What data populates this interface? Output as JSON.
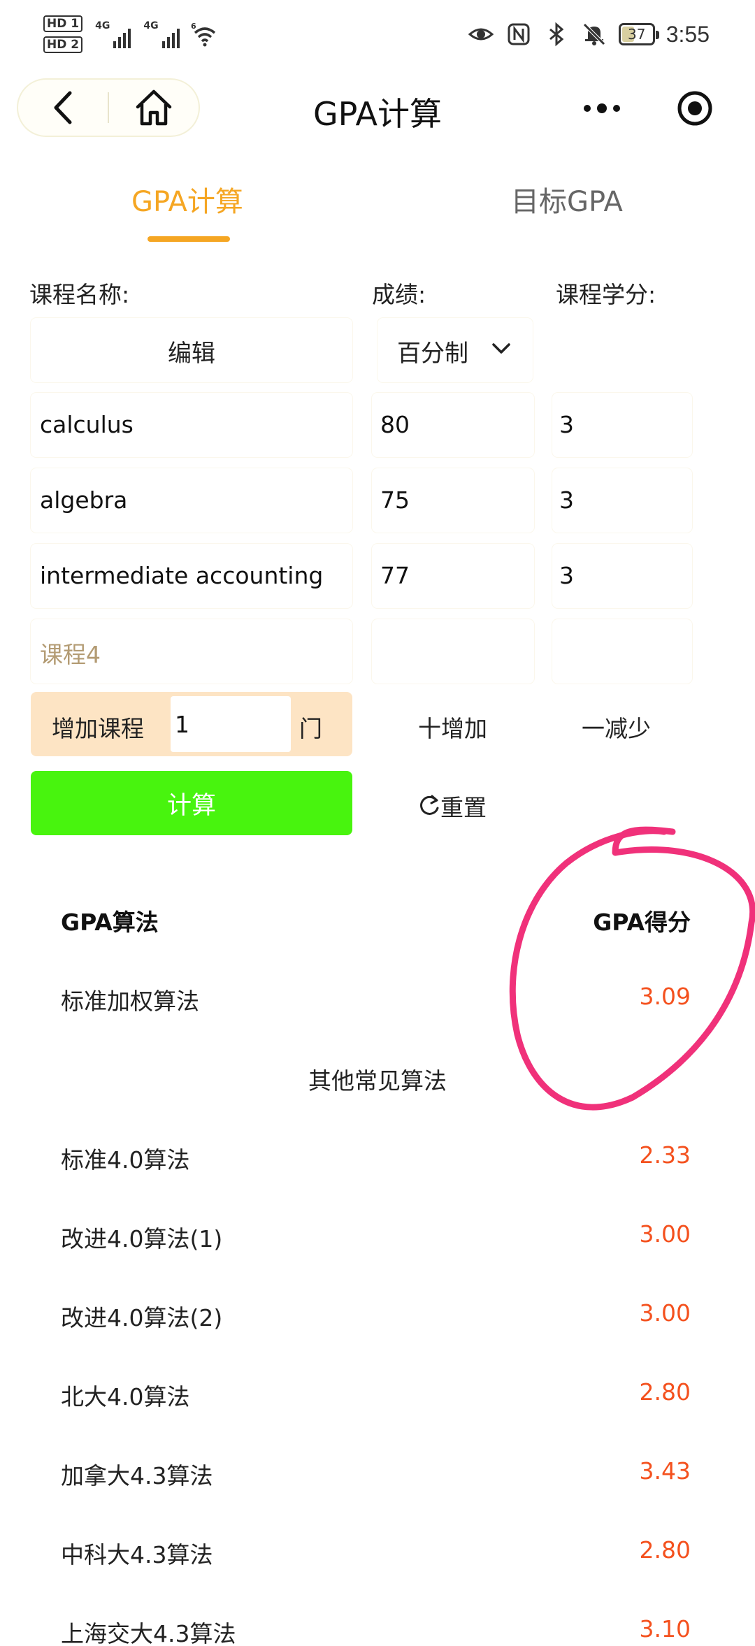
{
  "status_bar": {
    "hd_tags": [
      "HD 1",
      "HD 2"
    ],
    "network_1": "4G",
    "network_2": "4G",
    "wifi_badge": "6",
    "battery": "37",
    "time": "3:55",
    "icons": [
      "eye-icon",
      "nfc-icon",
      "bluetooth-icon",
      "mute-bell-icon"
    ]
  },
  "navbar": {
    "title": "GPA计算",
    "back_icon": "chevron-left-icon",
    "home_icon": "home-icon",
    "more_icon": "more-dots-icon",
    "close_icon": "target-icon"
  },
  "tabs": [
    {
      "label": "GPA计算",
      "active": true
    },
    {
      "label": "目标GPA",
      "active": false
    }
  ],
  "course_table": {
    "headers": {
      "name": "课程名称:",
      "score": "成绩:",
      "credit": "课程学分:"
    },
    "edit_label": "编辑",
    "scale_label": "百分制",
    "rows": [
      {
        "name": "calculus",
        "score": "80",
        "credit": "3"
      },
      {
        "name": "algebra",
        "score": "75",
        "credit": "3"
      },
      {
        "name": "intermediate accounting",
        "score": "77",
        "credit": "3"
      }
    ],
    "new_course_placeholder": "课程4"
  },
  "add_course": {
    "label": "增加课程",
    "value": "1",
    "unit": "门",
    "add_label": "十增加",
    "reduce_label": "一减少"
  },
  "actions": {
    "calculate": "计算",
    "reset": "重置"
  },
  "results": {
    "header_algo": "GPA算法",
    "header_score": "GPA得分",
    "standard": {
      "name": "标准加权算法",
      "value": "3.09"
    },
    "other_title": "其他常见算法",
    "others": [
      {
        "name": "标准4.0算法",
        "value": "2.33"
      },
      {
        "name": "改进4.0算法(1)",
        "value": "3.00"
      },
      {
        "name": "改进4.0算法(2)",
        "value": "3.00"
      },
      {
        "name": "北大4.0算法",
        "value": "2.80"
      },
      {
        "name": "加拿大4.3算法",
        "value": "3.43"
      },
      {
        "name": "中科大4.3算法",
        "value": "2.80"
      },
      {
        "name": "上海交大4.3算法",
        "value": "3.10"
      }
    ]
  },
  "colors": {
    "accent": "#f5a623",
    "calc_button": "#48f40e",
    "score_value": "#f4511e",
    "annotation": "#f0317a"
  }
}
